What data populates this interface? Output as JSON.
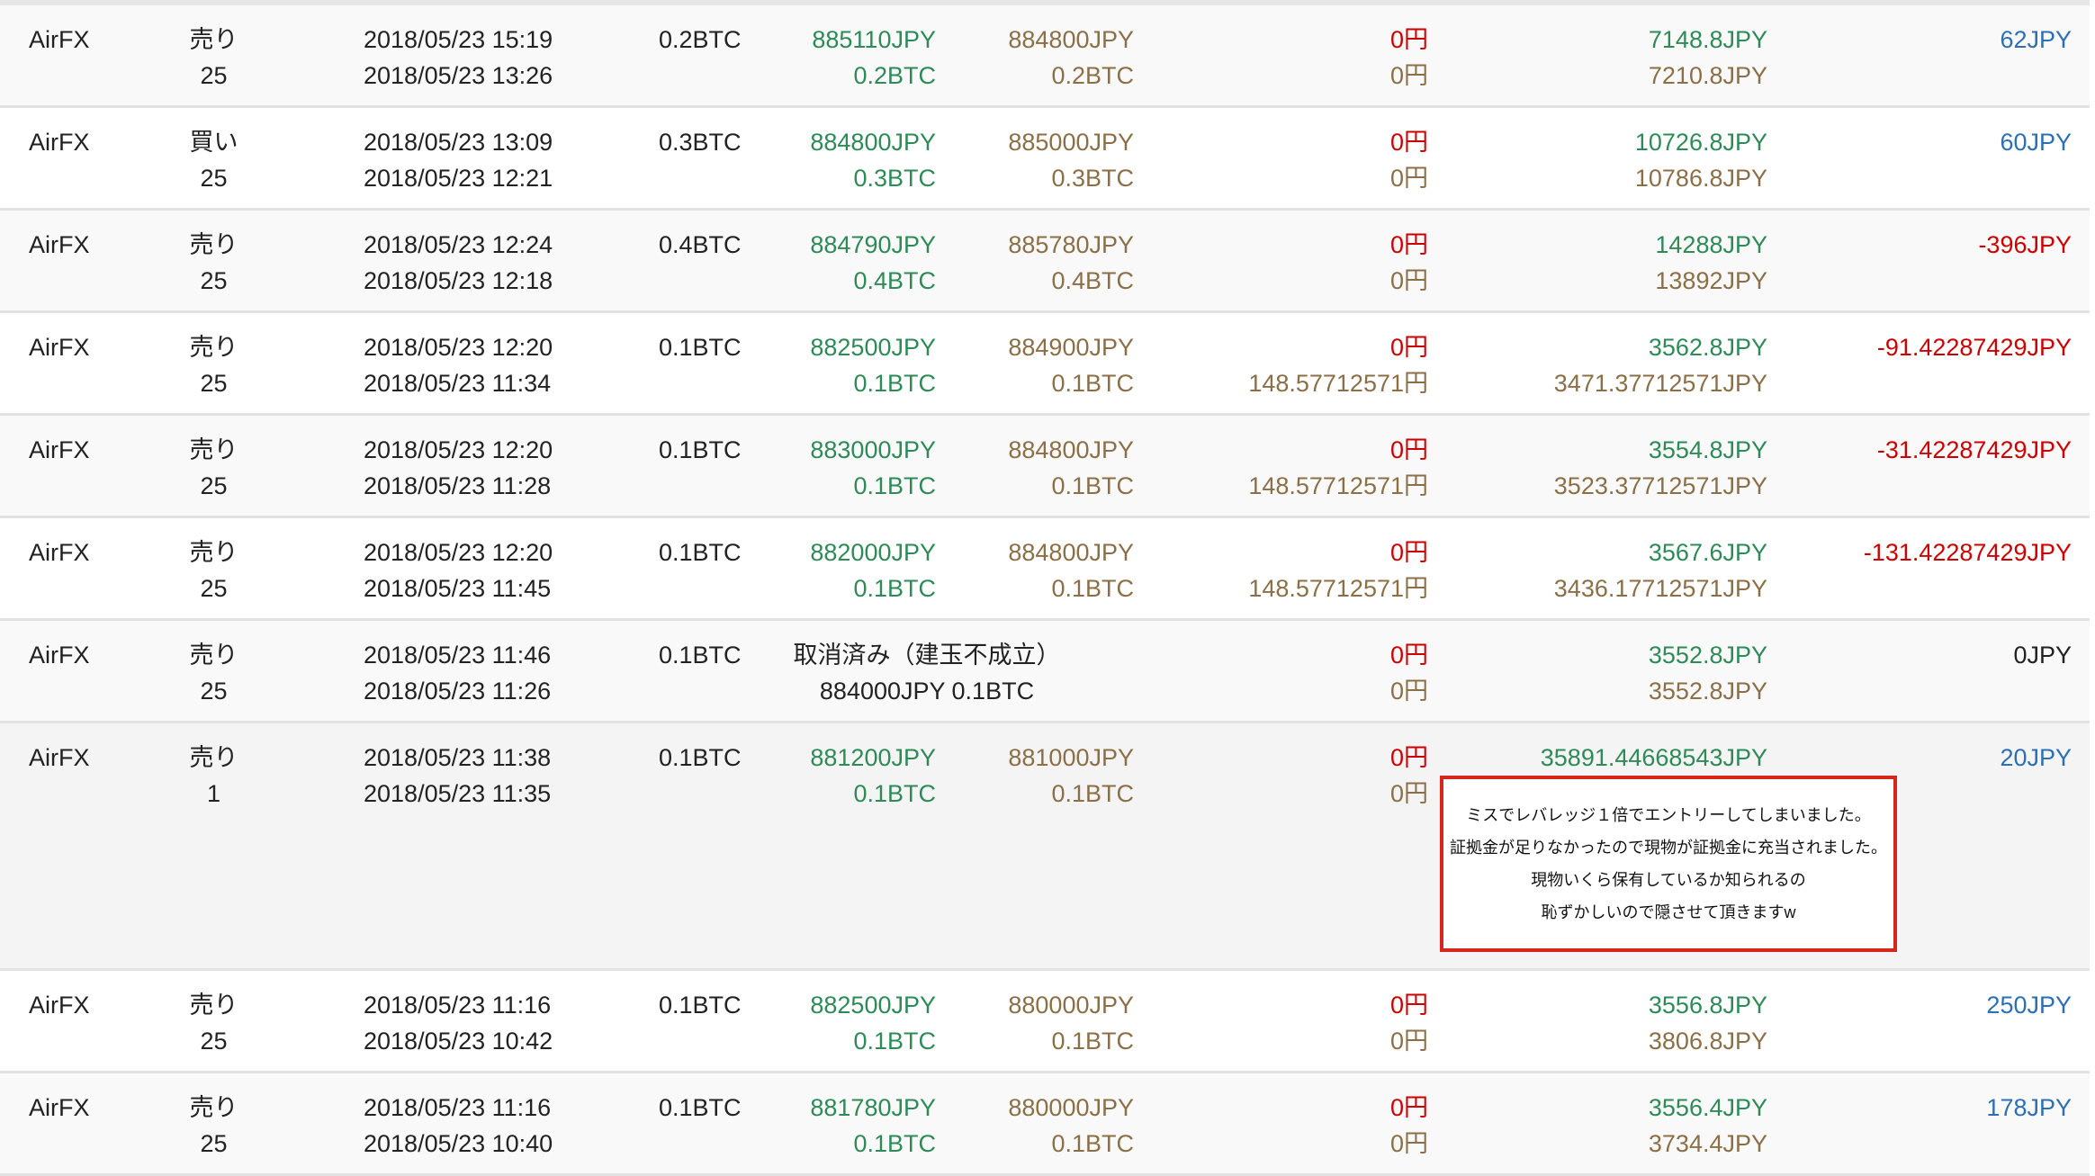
{
  "rows": [
    {
      "exchange": "AirFX",
      "side": "売り",
      "leverage": "25",
      "close_time": "2018/05/23 15:19",
      "open_time": "2018/05/23 13:26",
      "qty": "0.2BTC",
      "order_price": "885110JPY",
      "order_qty": "0.2BTC",
      "exec_price": "884800JPY",
      "exec_qty": "0.2BTC",
      "fee1": "0円",
      "fee2": "0円",
      "bal1": "7148.8JPY",
      "bal2": "7210.8JPY",
      "pl": "62JPY",
      "pl_sign": "pos"
    },
    {
      "exchange": "AirFX",
      "side": "買い",
      "leverage": "25",
      "close_time": "2018/05/23 13:09",
      "open_time": "2018/05/23 12:21",
      "qty": "0.3BTC",
      "order_price": "884800JPY",
      "order_qty": "0.3BTC",
      "exec_price": "885000JPY",
      "exec_qty": "0.3BTC",
      "fee1": "0円",
      "fee2": "0円",
      "bal1": "10726.8JPY",
      "bal2": "10786.8JPY",
      "pl": "60JPY",
      "pl_sign": "pos"
    },
    {
      "exchange": "AirFX",
      "side": "売り",
      "leverage": "25",
      "close_time": "2018/05/23 12:24",
      "open_time": "2018/05/23 12:18",
      "qty": "0.4BTC",
      "order_price": "884790JPY",
      "order_qty": "0.4BTC",
      "exec_price": "885780JPY",
      "exec_qty": "0.4BTC",
      "fee1": "0円",
      "fee2": "0円",
      "bal1": "14288JPY",
      "bal2": "13892JPY",
      "pl": "-396JPY",
      "pl_sign": "neg"
    },
    {
      "exchange": "AirFX",
      "side": "売り",
      "leverage": "25",
      "close_time": "2018/05/23 12:20",
      "open_time": "2018/05/23 11:34",
      "qty": "0.1BTC",
      "order_price": "882500JPY",
      "order_qty": "0.1BTC",
      "exec_price": "884900JPY",
      "exec_qty": "0.1BTC",
      "fee1": "0円",
      "fee2": "148.57712571円",
      "bal1": "3562.8JPY",
      "bal2": "3471.37712571JPY",
      "pl": "-91.42287429JPY",
      "pl_sign": "neg"
    },
    {
      "exchange": "AirFX",
      "side": "売り",
      "leverage": "25",
      "close_time": "2018/05/23 12:20",
      "open_time": "2018/05/23 11:28",
      "qty": "0.1BTC",
      "order_price": "883000JPY",
      "order_qty": "0.1BTC",
      "exec_price": "884800JPY",
      "exec_qty": "0.1BTC",
      "fee1": "0円",
      "fee2": "148.57712571円",
      "bal1": "3554.8JPY",
      "bal2": "3523.37712571JPY",
      "pl": "-31.42287429JPY",
      "pl_sign": "neg"
    },
    {
      "exchange": "AirFX",
      "side": "売り",
      "leverage": "25",
      "close_time": "2018/05/23 12:20",
      "open_time": "2018/05/23 11:45",
      "qty": "0.1BTC",
      "order_price": "882000JPY",
      "order_qty": "0.1BTC",
      "exec_price": "884800JPY",
      "exec_qty": "0.1BTC",
      "fee1": "0円",
      "fee2": "148.57712571円",
      "bal1": "3567.6JPY",
      "bal2": "3436.17712571JPY",
      "pl": "-131.42287429JPY",
      "pl_sign": "neg"
    },
    {
      "exchange": "AirFX",
      "side": "売り",
      "leverage": "25",
      "close_time": "2018/05/23 11:46",
      "open_time": "2018/05/23 11:26",
      "qty": "0.1BTC",
      "cancel_status": "取消済み（建玉不成立）",
      "cancel_detail": "884000JPY 0.1BTC",
      "fee1": "0円",
      "fee2": "0円",
      "bal1": "3552.8JPY",
      "bal2": "3552.8JPY",
      "pl": "0JPY",
      "pl_sign": "zero"
    },
    {
      "exchange": "AirFX",
      "side": "売り",
      "leverage": "1",
      "close_time": "2018/05/23 11:38",
      "open_time": "2018/05/23 11:35",
      "qty": "0.1BTC",
      "order_price": "881200JPY",
      "order_qty": "0.1BTC",
      "exec_price": "881000JPY",
      "exec_qty": "0.1BTC",
      "fee1": "0円",
      "fee2": "0円",
      "bal1": "35891.44668543JPY",
      "bal2": "",
      "pl": "20JPY",
      "pl_sign": "pos"
    },
    {
      "exchange": "AirFX",
      "side": "売り",
      "leverage": "25",
      "close_time": "2018/05/23 11:16",
      "open_time": "2018/05/23 10:42",
      "qty": "0.1BTC",
      "order_price": "882500JPY",
      "order_qty": "0.1BTC",
      "exec_price": "880000JPY",
      "exec_qty": "0.1BTC",
      "fee1": "0円",
      "fee2": "0円",
      "bal1": "3556.8JPY",
      "bal2": "3806.8JPY",
      "pl": "250JPY",
      "pl_sign": "pos"
    },
    {
      "exchange": "AirFX",
      "side": "売り",
      "leverage": "25",
      "close_time": "2018/05/23 11:16",
      "open_time": "2018/05/23 10:40",
      "qty": "0.1BTC",
      "order_price": "881780JPY",
      "order_qty": "0.1BTC",
      "exec_price": "880000JPY",
      "exec_qty": "0.1BTC",
      "fee1": "0円",
      "fee2": "0円",
      "bal1": "3556.4JPY",
      "bal2": "3734.4JPY",
      "pl": "178JPY",
      "pl_sign": "pos"
    }
  ],
  "annotation": {
    "lines": [
      "ミスでレバレッジ１倍でエントリーしてしまいました。",
      "証拠金が足りなかったので現物が証拠金に充当されました。",
      "現物いくら保有しているか知られるの",
      "恥ずかしいので隠させて頂きますw"
    ],
    "border_color": "#d9261c"
  },
  "colors": {
    "order_green": "#2e8b57",
    "exec_brown": "#8b6f47",
    "fee_red": "#cc0000",
    "profit_blue": "#2d6fb5",
    "loss_red": "#cc0000"
  }
}
